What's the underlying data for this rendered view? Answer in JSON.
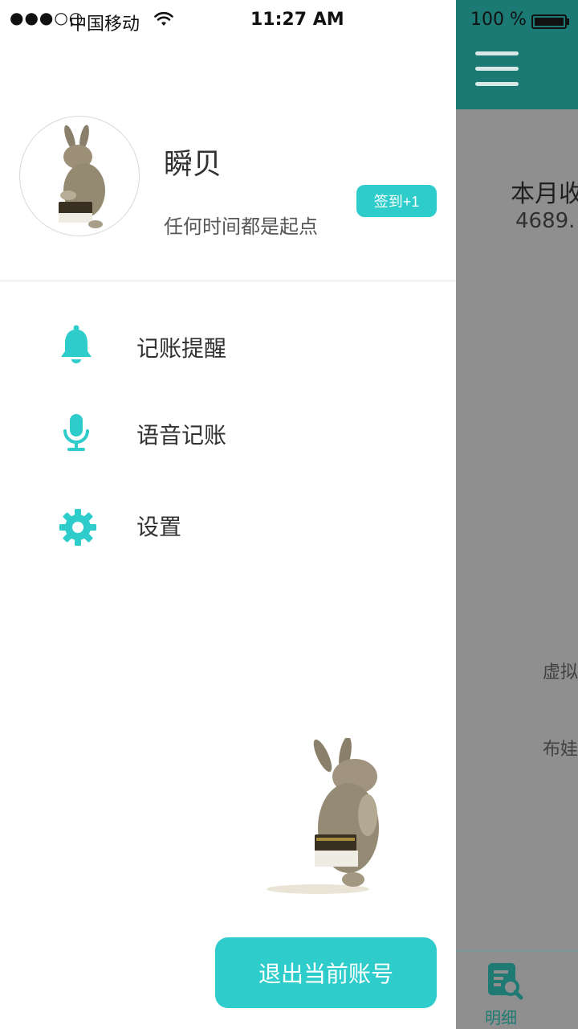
{
  "status_bar": {
    "signal": "●●●○○",
    "carrier": "中国移动",
    "time": "11:27 AM",
    "battery": "100 %"
  },
  "profile": {
    "name": "瞬贝",
    "slogan": "任何时间都是起点",
    "signin_label": "签到+1"
  },
  "menu": {
    "items": [
      {
        "label": "记账提醒",
        "icon": "bell-icon"
      },
      {
        "label": "语音记账",
        "icon": "microphone-icon"
      },
      {
        "label": "设置",
        "icon": "gear-icon"
      }
    ]
  },
  "logout_label": "退出当前账号",
  "background_app": {
    "month_label": "本月收",
    "month_value": "4689.",
    "item_1": "虚拟",
    "item_2": "布娃",
    "tab_label": "明细"
  },
  "colors": {
    "accent": "#2ecccb",
    "header_teal": "#1c7a74",
    "overlay_gray": "#8f8f8f",
    "title_text": "#313131",
    "subtitle_text": "#555555"
  }
}
